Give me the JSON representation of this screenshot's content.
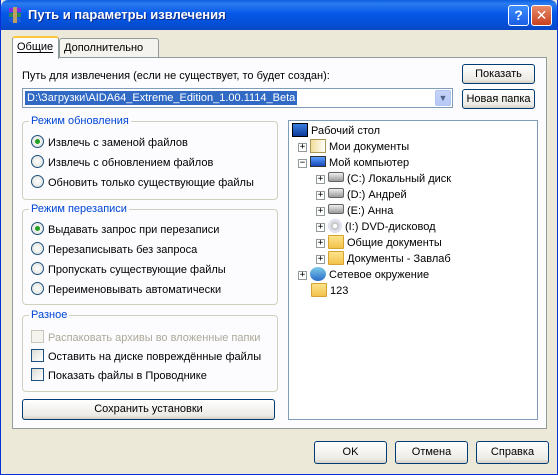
{
  "window": {
    "title": "Путь и параметры извлечения",
    "help_btn": "?",
    "close_btn": "✕"
  },
  "tabs": [
    {
      "label": "Общие",
      "active": true
    },
    {
      "label": "Дополнительно",
      "active": false
    }
  ],
  "path": {
    "label": "Путь для извлечения (если не существует, то будет создан):",
    "value": "D:\\Загрузки\\AIDA64_Extreme_Edition_1.00.1114_Beta",
    "show_button": "Показать",
    "new_folder_button": "Новая папка"
  },
  "update_mode": {
    "title": "Режим обновления",
    "options": [
      {
        "label": "Извлечь с заменой файлов",
        "selected": true
      },
      {
        "label": "Извлечь с обновлением файлов",
        "selected": false
      },
      {
        "label": "Обновить только существующие файлы",
        "selected": false
      }
    ]
  },
  "overwrite_mode": {
    "title": "Режим перезаписи",
    "options": [
      {
        "label": "Выдавать запрос при перезаписи",
        "selected": true
      },
      {
        "label": "Перезаписывать без запроса",
        "selected": false
      },
      {
        "label": "Пропускать существующие файлы",
        "selected": false
      },
      {
        "label": "Переименовывать автоматически",
        "selected": false
      }
    ]
  },
  "misc": {
    "title": "Разное",
    "options": [
      {
        "label": "Распаковать архивы во вложенные папки",
        "checked": false,
        "disabled": true
      },
      {
        "label": "Оставить на диске повреждённые файлы",
        "checked": false,
        "disabled": false
      },
      {
        "label": "Показать файлы в Проводнике",
        "checked": false,
        "disabled": false
      }
    ]
  },
  "save_settings_button": "Сохранить установки",
  "tree": [
    {
      "label": "Рабочий стол",
      "icon": "desktop-icon",
      "expander": ""
    },
    {
      "label": "Мои документы",
      "icon": "my-documents-icon",
      "expander": "+"
    },
    {
      "label": "Мой компьютер",
      "icon": "my-computer-icon",
      "expander": "−"
    },
    {
      "label": "(C:) Локальный диск",
      "icon": "drive-icon",
      "expander": "+"
    },
    {
      "label": "(D:) Андрей",
      "icon": "drive-icon",
      "expander": "+"
    },
    {
      "label": "(E:) Анна",
      "icon": "drive-icon",
      "expander": "+"
    },
    {
      "label": "(I:) DVD-дисковод",
      "icon": "dvd-drive-icon",
      "expander": "+"
    },
    {
      "label": "Общие документы",
      "icon": "folder-icon",
      "expander": "+"
    },
    {
      "label": "Документы - Завлаб",
      "icon": "folder-icon",
      "expander": "+"
    },
    {
      "label": "Сетевое окружение",
      "icon": "network-icon",
      "expander": "+"
    },
    {
      "label": "123",
      "icon": "folder-icon",
      "expander": ""
    }
  ],
  "footer": {
    "ok": "OK",
    "cancel": "Отмена",
    "help": "Справка"
  }
}
